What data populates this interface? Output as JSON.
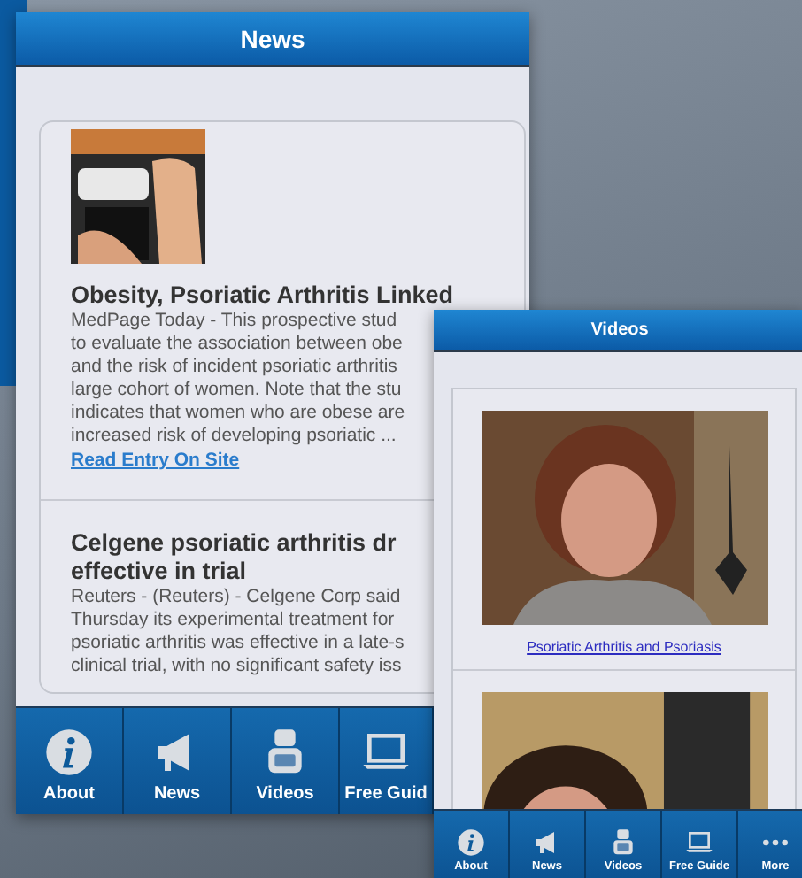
{
  "news_screen": {
    "title": "News",
    "articles": [
      {
        "title_lines": [
          "Obesity, Psoriatic Arthritis Linked"
        ],
        "body_lines": [
          "MedPage Today - This prospective stud",
          "to evaluate the association between obe",
          "and the risk of incident psoriatic arthritis",
          "large cohort of women. Note that the stu",
          "indicates that women who are obese are",
          "increased risk of developing psoriatic ..."
        ],
        "link": "Read Entry On Site"
      },
      {
        "kind": "text",
        "title_lines": [
          "Celgene psoriatic arthritis dr",
          "effective in trial"
        ],
        "body_lines": [
          "Reuters - (Reuters) - Celgene Corp said",
          "Thursday its experimental treatment for",
          "psoriatic arthritis was effective in a late-s",
          "clinical trial, with no significant safety iss"
        ]
      }
    ],
    "tabs": [
      {
        "label": "About"
      },
      {
        "label": "News"
      },
      {
        "label": "Videos"
      },
      {
        "label": "Free Guid"
      }
    ]
  },
  "videos_screen": {
    "title": "Videos",
    "videos": [
      {
        "kind": "picture",
        "caption": "Psoriatic Arthritis and Psoriasis"
      },
      {
        "kind": "picture"
      }
    ],
    "tabs": [
      {
        "label": "About"
      },
      {
        "label": "News"
      },
      {
        "label": "Videos"
      },
      {
        "label": "Free Guide"
      },
      {
        "label": "More"
      }
    ]
  }
}
